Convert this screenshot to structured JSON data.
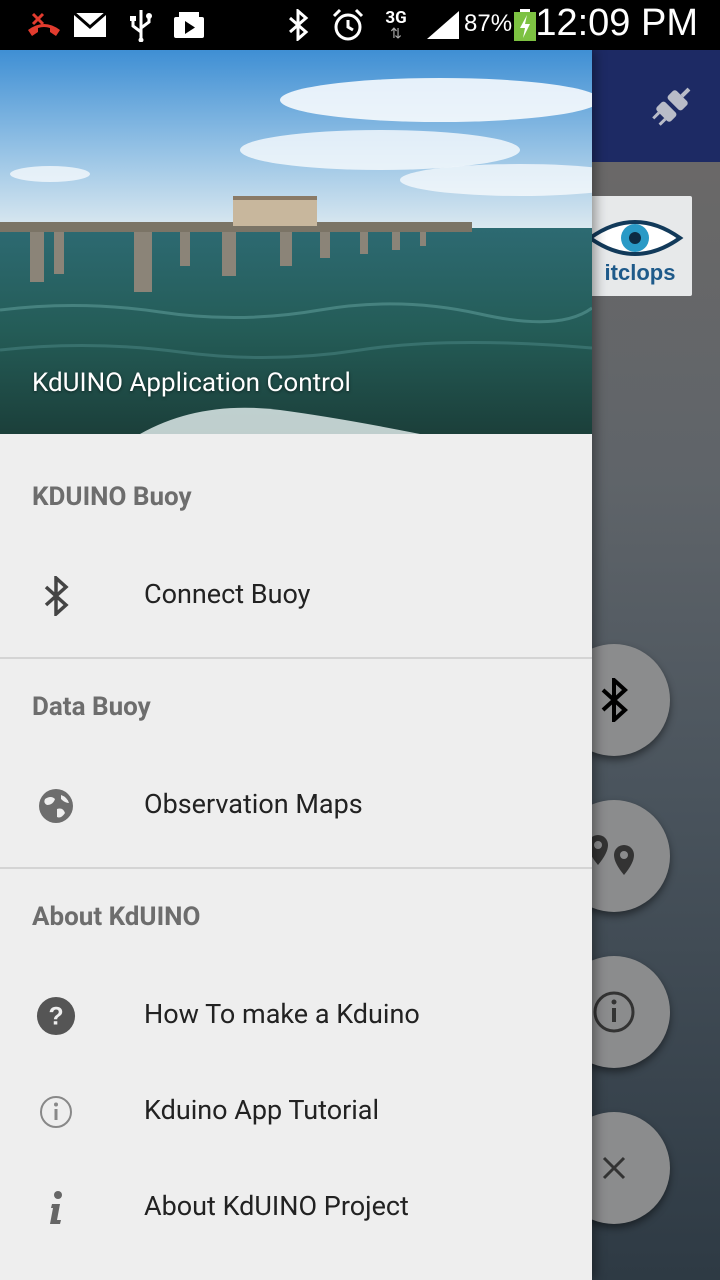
{
  "status_bar": {
    "battery": "87%",
    "time": "12:09 PM",
    "network": "3G"
  },
  "background_app": {
    "logo_text": "itclops"
  },
  "drawer": {
    "header_title": "KdUINO Application Control",
    "sections": [
      {
        "title": "KDUINO Buoy",
        "items": [
          {
            "label": "Connect Buoy",
            "icon": "bluetooth-icon"
          }
        ]
      },
      {
        "title": "Data Buoy",
        "items": [
          {
            "label": "Observation Maps",
            "icon": "globe-icon"
          }
        ]
      },
      {
        "title": "About KdUINO",
        "items": [
          {
            "label": "How To make a Kduino",
            "icon": "help-icon"
          },
          {
            "label": "Kduino App Tutorial",
            "icon": "info-circle-icon"
          },
          {
            "label": "About KdUINO Project",
            "icon": "info-icon"
          }
        ]
      }
    ]
  },
  "colors": {
    "toolbar": "#1d2a64",
    "drawer_bg": "#eeeeee",
    "section_title": "#6d6d6d",
    "fab": "#8b8c8d"
  }
}
